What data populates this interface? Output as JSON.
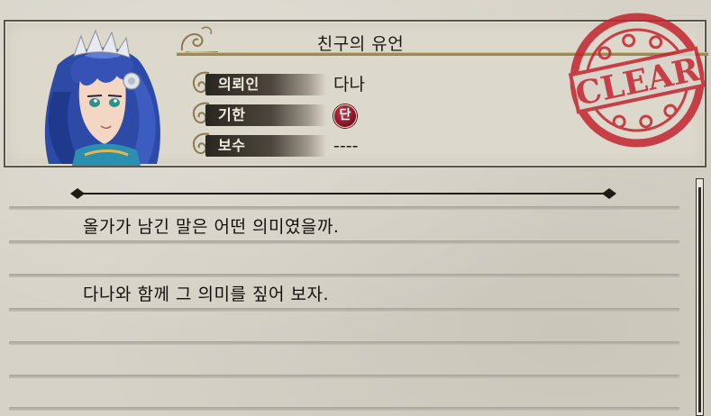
{
  "quest": {
    "title": "친구의 유언",
    "status_stamp": "CLEAR",
    "fields": [
      {
        "label": "의뢰인",
        "value": "다나"
      },
      {
        "label": "기한",
        "value": "단"
      },
      {
        "label": "보수",
        "value": "----"
      }
    ]
  },
  "description": {
    "lines": [
      "올가가 남긴 말은 어떤 의미였을까.",
      "다나와 함께 그 의미를 짚어 보자."
    ]
  },
  "colors": {
    "stamp_red": "#c4252f",
    "badge_red": "#9a1a2c",
    "label_bar_dark": "#2a2620",
    "parchment": "#d6d2c7"
  },
  "icons": {
    "portrait": "character-portrait",
    "stamp": "clear-stamp-icon",
    "curl": "scroll-curl-ornament-icon"
  }
}
